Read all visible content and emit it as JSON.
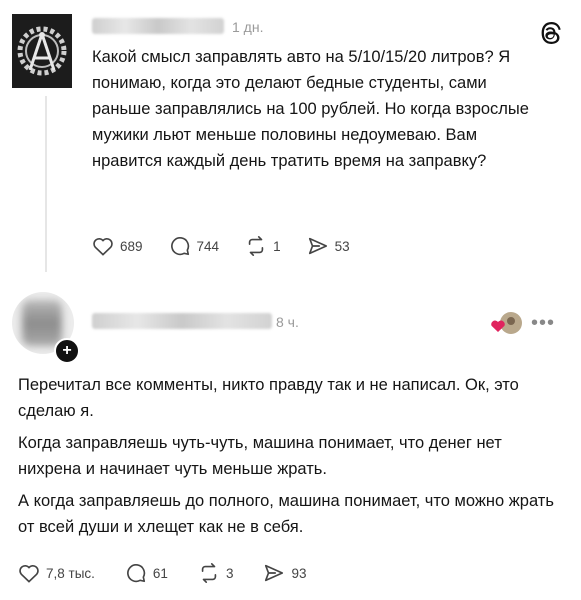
{
  "post1": {
    "time": "1 дн.",
    "paragraphs": [
      "Какой смысл заправлять авто на 5/10/15/20 литров? Я понимаю, когда это делают бедные студенты, сами раньше заправлялись на 100 рублей. Но когда взрослые мужики льют меньше половины недоумеваю. Вам нравится каждый день тратить время на заправку?"
    ],
    "likes": "689",
    "comments": "744",
    "reposts": "1",
    "shares": "53"
  },
  "post2": {
    "time": "8 ч.",
    "paragraphs": [
      "Перечитал все комменты, никто правду так и не написал. Ок, это сделаю я.",
      "Когда заправляешь чуть-чуть, машина понимает, что денег нет нихрена и начинает чуть меньше жрать.",
      "А когда заправляешь до полного, машина понимает, что можно жрать от всей души и хлещет как не в себя."
    ],
    "likes": "7,8 тыс.",
    "comments": "61",
    "reposts": "3",
    "shares": "93"
  },
  "icons": {
    "like": "heart-icon",
    "comment": "comment-icon",
    "repost": "repost-icon",
    "share": "share-icon",
    "app": "threads-logo-icon",
    "more": "more-icon"
  },
  "colors": {
    "text": "#111111",
    "muted": "#9a9a9a",
    "like_accent": "#e0245e"
  }
}
